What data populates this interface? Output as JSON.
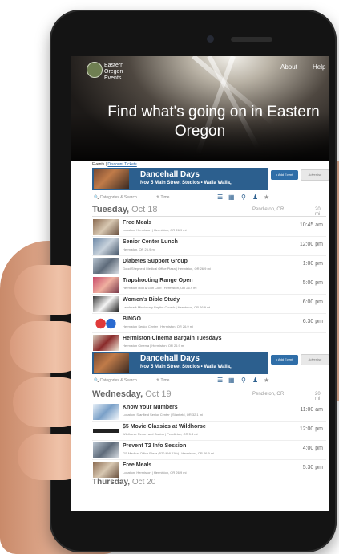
{
  "header": {
    "logo_text": "Eastern Oregon Events",
    "nav": {
      "about": "About",
      "help": "Help"
    },
    "hero_line1": "Find what's going on in Eastern",
    "hero_line2": "Oregon"
  },
  "tabs": {
    "events": "Events |",
    "discount": "Discount Tickets"
  },
  "banner": {
    "title": "Dancehall Days",
    "subtitle": "Nov 5   Main Street Studios   • Walla Walla,",
    "add_event": "• Add Event",
    "advertise": "Advertise"
  },
  "toolbar": {
    "categories": "🔍 Categories & Search",
    "time": "⇅ Time"
  },
  "days": [
    {
      "label": "Tuesday,",
      "date": "Oct 18",
      "location": "Pendleton, OR",
      "distance": "20 mi",
      "events": [
        {
          "title": "Free Meals",
          "sub": "Location: Hermiston | Hermiston, OR   26.9 mi",
          "time": "10:45 am"
        },
        {
          "title": "Senior Center Lunch",
          "sub": "Hermiston, OR   26.9 mi",
          "time": "12:00 pm"
        },
        {
          "title": "Diabetes Support Group",
          "sub": "Good Shepherd Medical Office Plaza | Hermiston, OR   26.9 mi",
          "time": "1:00 pm"
        },
        {
          "title": "Trapshooting Range Open",
          "sub": "Hermiston Rod & Gun Club | Hermiston, OR   26.9 mi",
          "time": "5:00 pm"
        },
        {
          "title": "Women's Bible Study",
          "sub": "Landmark Missionary Baptist Church | Hermiston, OR   26.9 mi",
          "time": "6:00 pm"
        },
        {
          "title": "BINGO",
          "sub": "Hermiston Senior Center | Hermiston, OR   26.9 mi",
          "time": "6:30 pm"
        },
        {
          "title": "Hermiston Cinema Bargain Tuesdays",
          "sub": "Hermiston Cinema | Hermiston, OR   26.9 mi",
          "time": ""
        }
      ]
    },
    {
      "label": "Wednesday,",
      "date": "Oct 19",
      "location": "Pendleton, OR",
      "distance": "20 mi",
      "events": [
        {
          "title": "Know Your Numbers",
          "sub": "Location: Stanfield Senior Center | Stanfield, OR   32.1 mi",
          "time": "11:00 am"
        },
        {
          "title": "$5 Movie Classics at Wildhorse",
          "sub": "Wildhorse Resort and Casino | Pendleton, OR   5.8 mi",
          "time": "12:00 pm"
        },
        {
          "title": "Prevent T2 Info Session",
          "sub": "GS Medical Office Plaza (520 NW 11th) | Hermiston, OR   26.9 mi",
          "time": "4:00 pm"
        },
        {
          "title": "Free Meals",
          "sub": "Location: Hermiston | Hermiston, OR   26.9 mi",
          "time": "5:30 pm"
        }
      ]
    }
  ],
  "thursday": {
    "label": "Thursday,",
    "date": "Oct 20"
  },
  "colors": {
    "banner": "#2c5f8e",
    "accent": "#2a6aa8"
  }
}
